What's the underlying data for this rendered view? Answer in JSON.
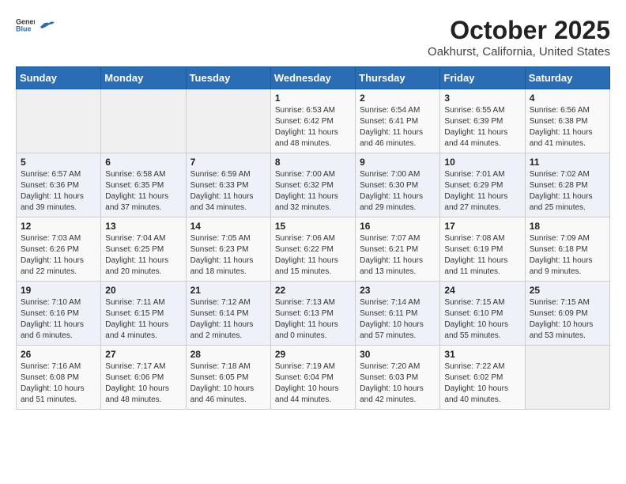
{
  "header": {
    "logo_general": "General",
    "logo_blue": "Blue",
    "month": "October 2025",
    "location": "Oakhurst, California, United States"
  },
  "weekdays": [
    "Sunday",
    "Monday",
    "Tuesday",
    "Wednesday",
    "Thursday",
    "Friday",
    "Saturday"
  ],
  "weeks": [
    [
      {
        "day": "",
        "info": ""
      },
      {
        "day": "",
        "info": ""
      },
      {
        "day": "",
        "info": ""
      },
      {
        "day": "1",
        "info": "Sunrise: 6:53 AM\nSunset: 6:42 PM\nDaylight: 11 hours and 48 minutes."
      },
      {
        "day": "2",
        "info": "Sunrise: 6:54 AM\nSunset: 6:41 PM\nDaylight: 11 hours and 46 minutes."
      },
      {
        "day": "3",
        "info": "Sunrise: 6:55 AM\nSunset: 6:39 PM\nDaylight: 11 hours and 44 minutes."
      },
      {
        "day": "4",
        "info": "Sunrise: 6:56 AM\nSunset: 6:38 PM\nDaylight: 11 hours and 41 minutes."
      }
    ],
    [
      {
        "day": "5",
        "info": "Sunrise: 6:57 AM\nSunset: 6:36 PM\nDaylight: 11 hours and 39 minutes."
      },
      {
        "day": "6",
        "info": "Sunrise: 6:58 AM\nSunset: 6:35 PM\nDaylight: 11 hours and 37 minutes."
      },
      {
        "day": "7",
        "info": "Sunrise: 6:59 AM\nSunset: 6:33 PM\nDaylight: 11 hours and 34 minutes."
      },
      {
        "day": "8",
        "info": "Sunrise: 7:00 AM\nSunset: 6:32 PM\nDaylight: 11 hours and 32 minutes."
      },
      {
        "day": "9",
        "info": "Sunrise: 7:00 AM\nSunset: 6:30 PM\nDaylight: 11 hours and 29 minutes."
      },
      {
        "day": "10",
        "info": "Sunrise: 7:01 AM\nSunset: 6:29 PM\nDaylight: 11 hours and 27 minutes."
      },
      {
        "day": "11",
        "info": "Sunrise: 7:02 AM\nSunset: 6:28 PM\nDaylight: 11 hours and 25 minutes."
      }
    ],
    [
      {
        "day": "12",
        "info": "Sunrise: 7:03 AM\nSunset: 6:26 PM\nDaylight: 11 hours and 22 minutes."
      },
      {
        "day": "13",
        "info": "Sunrise: 7:04 AM\nSunset: 6:25 PM\nDaylight: 11 hours and 20 minutes."
      },
      {
        "day": "14",
        "info": "Sunrise: 7:05 AM\nSunset: 6:23 PM\nDaylight: 11 hours and 18 minutes."
      },
      {
        "day": "15",
        "info": "Sunrise: 7:06 AM\nSunset: 6:22 PM\nDaylight: 11 hours and 15 minutes."
      },
      {
        "day": "16",
        "info": "Sunrise: 7:07 AM\nSunset: 6:21 PM\nDaylight: 11 hours and 13 minutes."
      },
      {
        "day": "17",
        "info": "Sunrise: 7:08 AM\nSunset: 6:19 PM\nDaylight: 11 hours and 11 minutes."
      },
      {
        "day": "18",
        "info": "Sunrise: 7:09 AM\nSunset: 6:18 PM\nDaylight: 11 hours and 9 minutes."
      }
    ],
    [
      {
        "day": "19",
        "info": "Sunrise: 7:10 AM\nSunset: 6:16 PM\nDaylight: 11 hours and 6 minutes."
      },
      {
        "day": "20",
        "info": "Sunrise: 7:11 AM\nSunset: 6:15 PM\nDaylight: 11 hours and 4 minutes."
      },
      {
        "day": "21",
        "info": "Sunrise: 7:12 AM\nSunset: 6:14 PM\nDaylight: 11 hours and 2 minutes."
      },
      {
        "day": "22",
        "info": "Sunrise: 7:13 AM\nSunset: 6:13 PM\nDaylight: 11 hours and 0 minutes."
      },
      {
        "day": "23",
        "info": "Sunrise: 7:14 AM\nSunset: 6:11 PM\nDaylight: 10 hours and 57 minutes."
      },
      {
        "day": "24",
        "info": "Sunrise: 7:15 AM\nSunset: 6:10 PM\nDaylight: 10 hours and 55 minutes."
      },
      {
        "day": "25",
        "info": "Sunrise: 7:15 AM\nSunset: 6:09 PM\nDaylight: 10 hours and 53 minutes."
      }
    ],
    [
      {
        "day": "26",
        "info": "Sunrise: 7:16 AM\nSunset: 6:08 PM\nDaylight: 10 hours and 51 minutes."
      },
      {
        "day": "27",
        "info": "Sunrise: 7:17 AM\nSunset: 6:06 PM\nDaylight: 10 hours and 48 minutes."
      },
      {
        "day": "28",
        "info": "Sunrise: 7:18 AM\nSunset: 6:05 PM\nDaylight: 10 hours and 46 minutes."
      },
      {
        "day": "29",
        "info": "Sunrise: 7:19 AM\nSunset: 6:04 PM\nDaylight: 10 hours and 44 minutes."
      },
      {
        "day": "30",
        "info": "Sunrise: 7:20 AM\nSunset: 6:03 PM\nDaylight: 10 hours and 42 minutes."
      },
      {
        "day": "31",
        "info": "Sunrise: 7:22 AM\nSunset: 6:02 PM\nDaylight: 10 hours and 40 minutes."
      },
      {
        "day": "",
        "info": ""
      }
    ]
  ]
}
